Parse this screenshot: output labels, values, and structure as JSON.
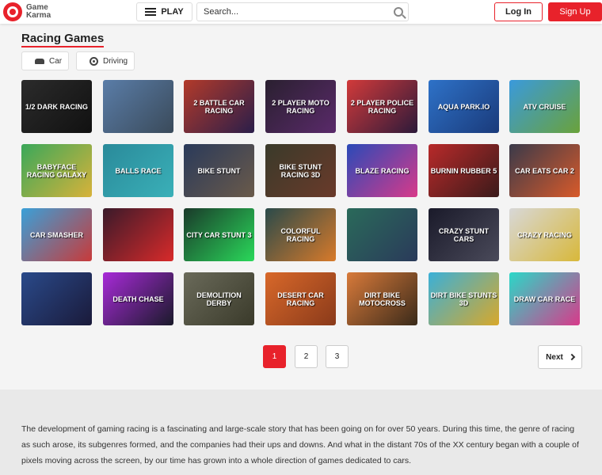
{
  "header": {
    "logo_line1": "Game",
    "logo_line2": "Karma",
    "play_label": "PLAY",
    "search_placeholder": "Search...",
    "login_label": "Log In",
    "signup_label": "Sign Up"
  },
  "page": {
    "title": "Racing Games",
    "tags": [
      {
        "label": "Car",
        "icon": "car-icon"
      },
      {
        "label": "Driving",
        "icon": "steering-wheel-icon"
      }
    ]
  },
  "games": [
    {
      "label": "1/2 Dark Racing",
      "c1": "#2b2b2b",
      "c2": "#111111"
    },
    {
      "label": "",
      "c1": "#5a7da8",
      "c2": "#3a4a5a"
    },
    {
      "label": "2 Battle Car Racing",
      "c1": "#b33a2a",
      "c2": "#2a1e4a"
    },
    {
      "label": "2 Player Moto Racing",
      "c1": "#2a2030",
      "c2": "#5a2a6a"
    },
    {
      "label": "2 Player Police Racing",
      "c1": "#d23a3a",
      "c2": "#2c1a3a"
    },
    {
      "label": "Aqua Park.io",
      "c1": "#2e72c8",
      "c2": "#1a3a7a"
    },
    {
      "label": "ATV Cruise",
      "c1": "#3a9adc",
      "c2": "#6aa23a"
    },
    {
      "label": "Babyface Racing Galaxy",
      "c1": "#3aa85a",
      "c2": "#d8b23a"
    },
    {
      "label": "Balls Race",
      "c1": "#2a8a9a",
      "c2": "#3ab0b8"
    },
    {
      "label": "Bike Stunt",
      "c1": "#2a3a5a",
      "c2": "#6a5a4a"
    },
    {
      "label": "Bike Stunt Racing 3D",
      "c1": "#3a3a2a",
      "c2": "#6a3a2a"
    },
    {
      "label": "Blaze Racing",
      "c1": "#2a4ab8",
      "c2": "#d83a8a"
    },
    {
      "label": "Burnin Rubber 5",
      "c1": "#b82a2a",
      "c2": "#3a1a1a"
    },
    {
      "label": "Car Eats Car 2",
      "c1": "#3a3a4a",
      "c2": "#d85a2a"
    },
    {
      "label": "Car Smasher",
      "c1": "#3aa0d8",
      "c2": "#c83a3a"
    },
    {
      "label": "",
      "c1": "#3a1a2a",
      "c2": "#d82a2a"
    },
    {
      "label": "City Car Stunt 3",
      "c1": "#1a3a2a",
      "c2": "#2ad85a"
    },
    {
      "label": "Colorful Racing",
      "c1": "#2a4a4a",
      "c2": "#d87a2a"
    },
    {
      "label": "",
      "c1": "#2a6a5a",
      "c2": "#2a3a5a"
    },
    {
      "label": "Crazy Stunt Cars",
      "c1": "#1a1a2a",
      "c2": "#4a4a5a"
    },
    {
      "label": "Crazy Racing",
      "c1": "#d8d8d8",
      "c2": "#d8b83a"
    },
    {
      "label": "",
      "c1": "#2a4a8a",
      "c2": "#1a1a3a"
    },
    {
      "label": "Death Chase",
      "c1": "#a82ad8",
      "c2": "#1a1a2a"
    },
    {
      "label": "Demolition Derby",
      "c1": "#6a6a5a",
      "c2": "#3a3a2a"
    },
    {
      "label": "Desert Car Racing",
      "c1": "#d8682a",
      "c2": "#8a3a1a"
    },
    {
      "label": "Dirt Bike Motocross",
      "c1": "#d87a3a",
      "c2": "#3a2a1a"
    },
    {
      "label": "Dirt Bike Stunts 3D",
      "c1": "#3ab0d8",
      "c2": "#d8a82a"
    },
    {
      "label": "Draw Car Race",
      "c1": "#2ad8c8",
      "c2": "#d83a8a"
    }
  ],
  "pagination": {
    "pages": [
      "1",
      "2",
      "3"
    ],
    "active": "1",
    "next_label": "Next"
  },
  "description": {
    "paragraph1": "The development of gaming racing is a fascinating and large-scale story that has been going on for over 50 years. During this time, the genre of racing as such arose, its subgenres formed, and the companies had their ups and downs. And what in the distant 70s of the XX century began with a couple of pixels moving across the screen, by our time has grown into a whole direction of games dedicated to cars.",
    "paragraph2": ""
  }
}
